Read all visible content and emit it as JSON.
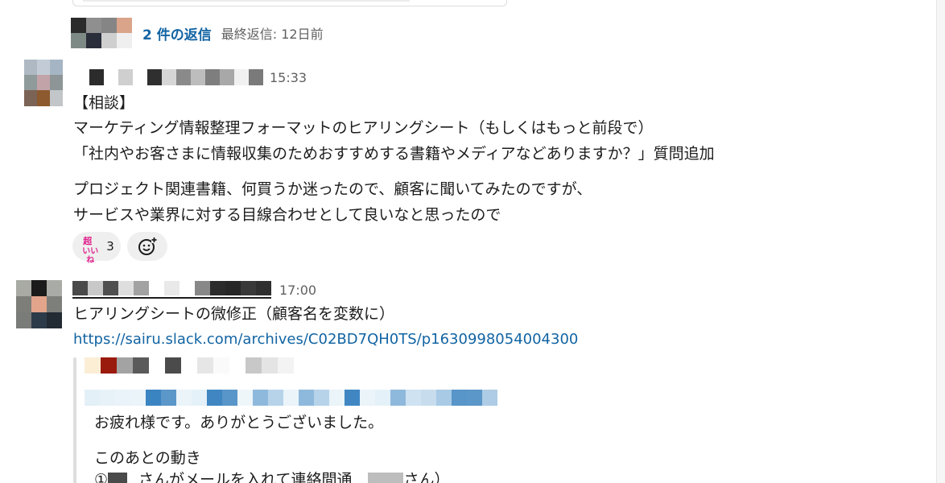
{
  "thread": {
    "reply_link": "2 件の返信",
    "last_reply": "最終返信: 12日前"
  },
  "message1": {
    "timestamp": "15:33",
    "lines": [
      "【相談】",
      "マーケティング情報整理フォーマットのヒアリングシート（もしくはもっと前段で）",
      "「社内やお客さまに情報収集のためおすすめする書籍やメディアなどありますか？」質問追加",
      "プロジェクト関連書籍、何買うか迷ったので、顧客に聞いてみたのですが、",
      "サービスや業界に対する目線合わせとして良いなと思ったので"
    ],
    "reaction": {
      "emoji_icon": "cho-iine-emoji-icon",
      "emoji_line1": "超",
      "emoji_line2": "いいね",
      "count": "3"
    },
    "add_reaction_icon": "add-reaction-icon"
  },
  "message2": {
    "timestamp": "17:00",
    "text": "ヒアリングシートの微修正（顧客名を変数に）",
    "link": "https://sairu.slack.com/archives/C02BD7QH0TS/p1630998054004300",
    "quote": {
      "line1": "お疲れ様です。ありがとうございました。",
      "line2": "このあとの動き",
      "line3_part1": "①",
      "line3_part2": "さんがメールを入れて連絡間通",
      "line3_part3": "さん）"
    }
  },
  "colors": {
    "link": "#1264a3",
    "meta": "#616061",
    "text": "#1d1c1d",
    "reaction_bg": "#efefef"
  }
}
